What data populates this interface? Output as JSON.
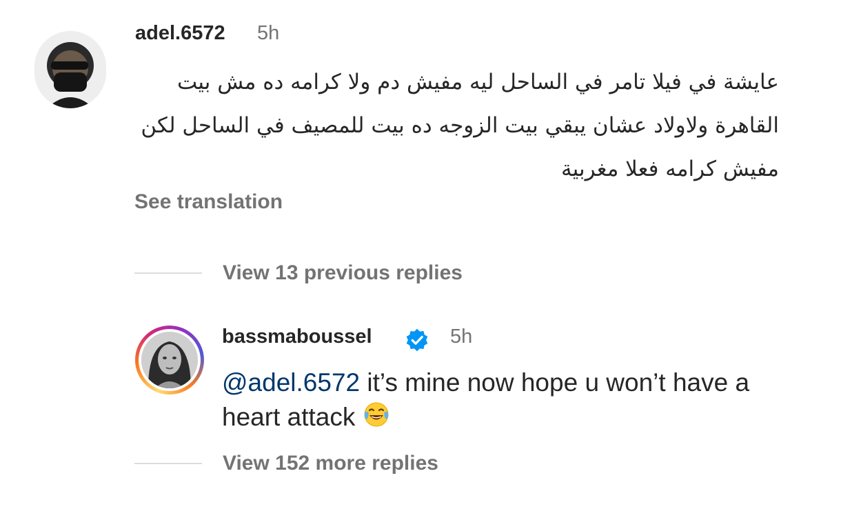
{
  "comment": {
    "username": "adel.6572",
    "time": "5h",
    "text": "عايشة في فيلا تامر في الساحل ليه مفيش دم ولا كرامه ده مش بيت القاهرة ولاولاد عشان يبقي بيت الزوجه ده بيت للمصيف في الساحل لكن مفيش كرامه فعلا مغربية",
    "see_translation": "See translation",
    "view_previous_replies": "View 13 previous replies"
  },
  "reply": {
    "username": "bassmaboussel",
    "verified": true,
    "time": "5h",
    "mention": "@adel.6572",
    "text": " it’s mine now hope u won’t have a heart attack ",
    "emoji": "face-with-tears-of-joy-icon"
  },
  "view_more_replies": "View 152 more replies",
  "colors": {
    "text": "#262626",
    "secondary": "#737373",
    "mention": "#00376b",
    "verified": "#0095f6"
  }
}
